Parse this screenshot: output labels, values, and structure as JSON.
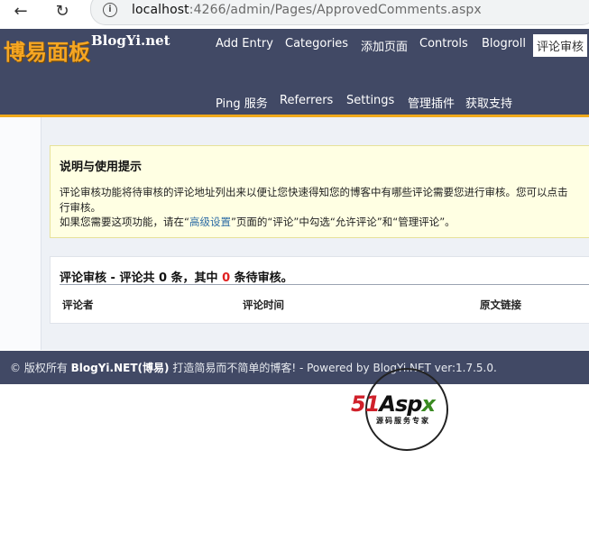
{
  "browser": {
    "url_host": "localhost",
    "url_path": ":4266/admin/Pages/ApprovedComments.aspx"
  },
  "header": {
    "logo_cn": "博易面板",
    "logo_en": "BlogYi.net",
    "menu_row1": [
      "Add Entry",
      "Categories",
      "添加页面",
      "Controls",
      "Blogroll",
      "评论审核"
    ],
    "menu_row2": [
      "Ping 服务",
      "Referrers",
      "Settings",
      "管理插件",
      "获取支持"
    ],
    "active_item": "评论审核"
  },
  "notice": {
    "title": "说明与使用提示",
    "line1": "评论审核功能将待审核的评论地址列出来以便让您快速得知您的博客中有哪些评论需要您进行审核。您可以点击",
    "line2": "行审核。",
    "line3_pre": "如果您需要这项功能，请在“",
    "line3_link": "高级设置",
    "line3_post": "”页面的“评论”中勾选“允许评论”和“管理评论”。"
  },
  "comments": {
    "title_pre": "评论审核 - 评论共 0 条，其中 ",
    "pending_count": "0",
    "title_post": " 条待审核。",
    "columns": [
      "评论者",
      "评论时间",
      "原文链接"
    ]
  },
  "footer": {
    "copyright_pre": "© 版权所有 ",
    "brand": "BlogYi.NET(博易)",
    "slogan": " 打造简易而不简单的博客!",
    "powered": " - Powered by BlogYi.NET ver:1.7.5.0."
  },
  "watermark": {
    "text_red": "51",
    "text_black": "Asp",
    "text_green": "x",
    "sub": "源码服务专家"
  }
}
